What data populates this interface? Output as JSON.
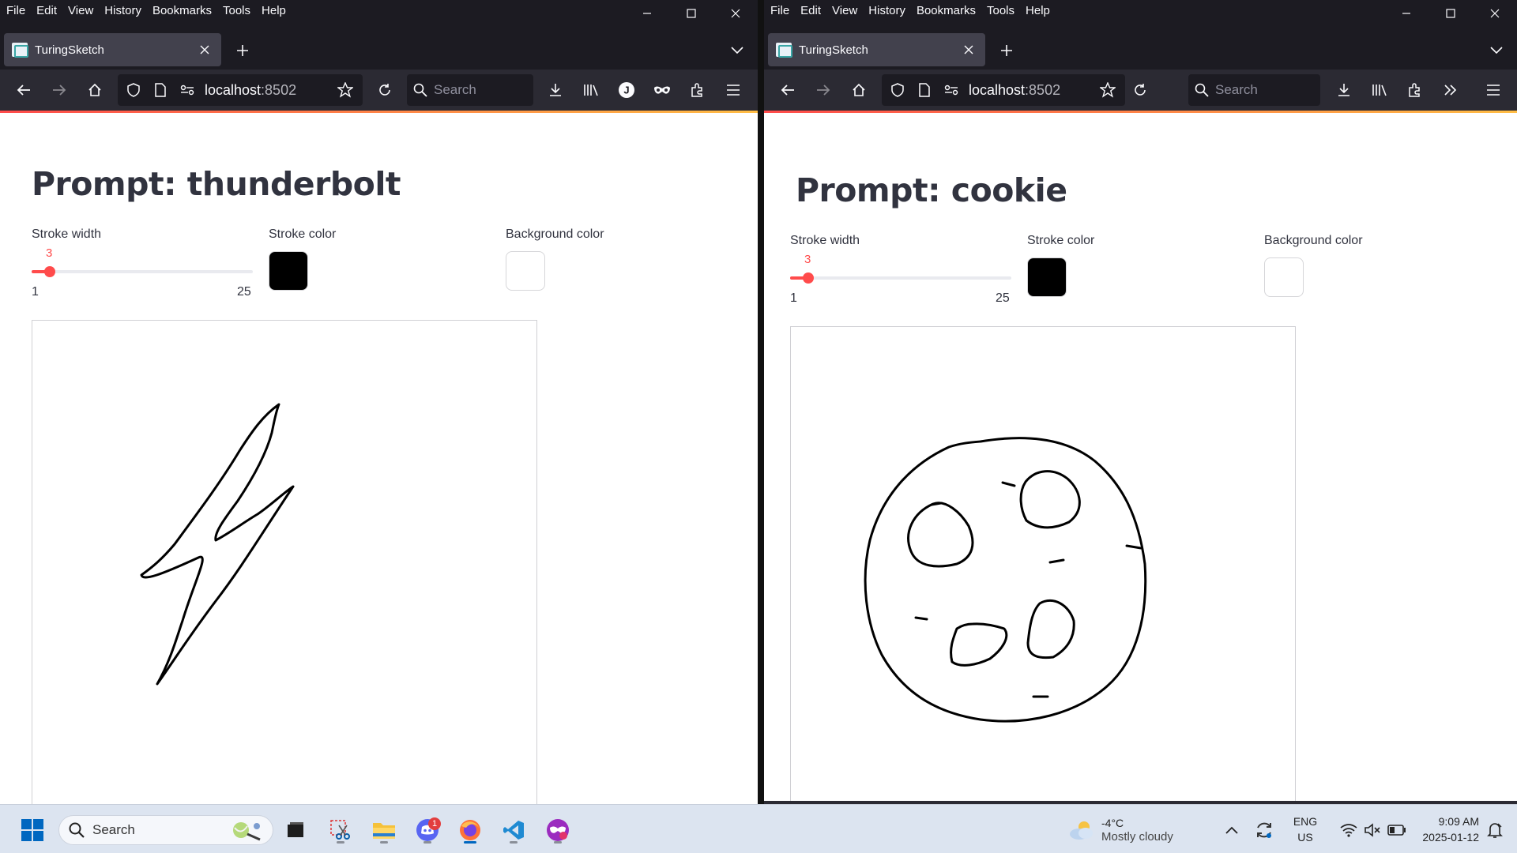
{
  "menu": [
    "File",
    "Edit",
    "View",
    "History",
    "Bookmarks",
    "Tools",
    "Help"
  ],
  "windows": [
    {
      "tab_title": "TuringSketch",
      "url_host": "localhost",
      "url_port": ":8502",
      "search_placeholder": "Search",
      "prompt": "Prompt: thunderbolt",
      "stroke_width_label": "Stroke width",
      "stroke_width_value": "3",
      "stroke_width_min": "1",
      "stroke_width_max": "25",
      "stroke_color_label": "Stroke color",
      "stroke_color": "#000000",
      "background_color_label": "Background color",
      "background_color": "#ffffff",
      "drawing": "thunderbolt"
    },
    {
      "tab_title": "TuringSketch",
      "url_host": "localhost",
      "url_port": ":8502",
      "search_placeholder": "Search",
      "prompt": "Prompt: cookie",
      "stroke_width_label": "Stroke width",
      "stroke_width_value": "3",
      "stroke_width_min": "1",
      "stroke_width_max": "25",
      "stroke_color_label": "Stroke color",
      "stroke_color": "#000000",
      "background_color_label": "Background color",
      "background_color": "#ffffff",
      "drawing": "cookie"
    }
  ],
  "taskbar": {
    "search_placeholder": "Search",
    "discord_badge": "1",
    "weather_temp": "-4°C",
    "weather_desc": "Mostly cloudy",
    "lang_line1": "ENG",
    "lang_line2": "US",
    "time": "9:09 AM",
    "date": "2025-01-12"
  },
  "colors": {
    "accent": "#ff4b4b",
    "chrome_dark": "#1c1b22",
    "toolbar": "#2b2a33",
    "tab_active": "#42414d",
    "heading": "#31333f"
  }
}
